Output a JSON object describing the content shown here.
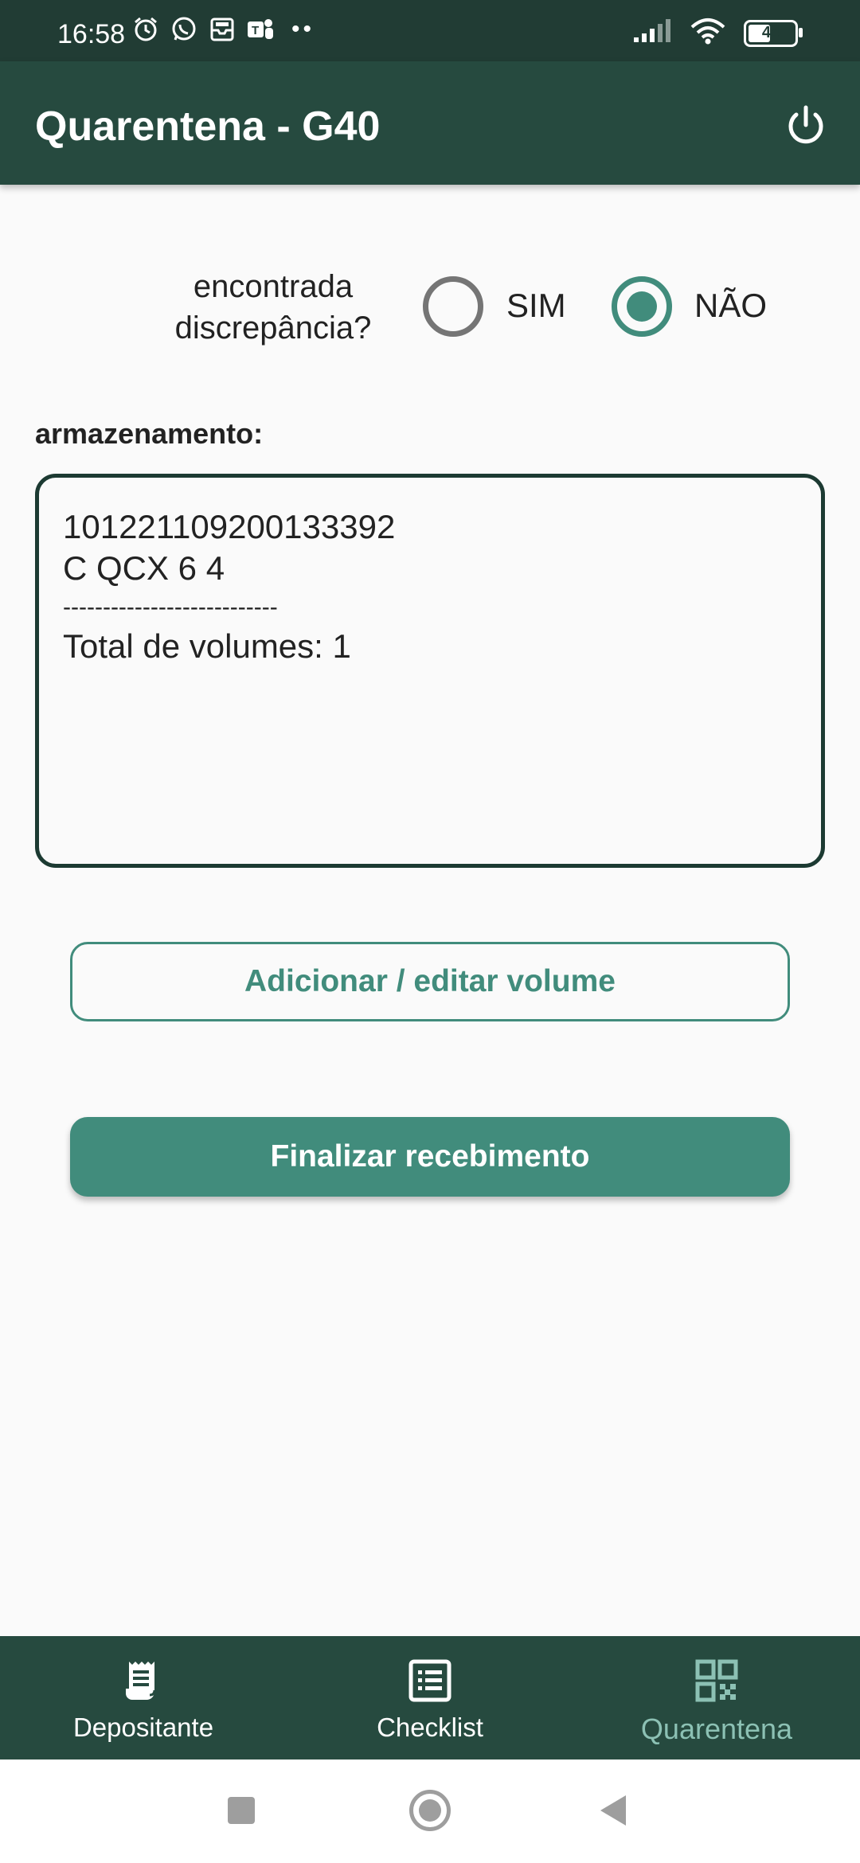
{
  "status_bar": {
    "time": "16:58",
    "battery": "44",
    "icons": [
      "alarm-icon",
      "whatsapp-icon",
      "inbox-icon",
      "teams-icon",
      "more-dots-icon",
      "signal-icon",
      "wifi-icon",
      "battery-icon"
    ]
  },
  "appbar": {
    "title": "Quarentena - G40",
    "power_icon": "power-icon"
  },
  "discrepancy": {
    "question_line1": "encontrada",
    "question_line2": "discrepância?",
    "option_yes": "SIM",
    "option_no": "NÃO",
    "selected": "NÃO"
  },
  "storage": {
    "label": "armazenamento:",
    "lines": [
      "101221109200133392",
      "C QCX 6 4",
      "---------------------------",
      "Total de volumes: 1"
    ]
  },
  "buttons": {
    "add_edit": "Adicionar / editar volume",
    "finish": "Finalizar recebimento"
  },
  "bottom_nav": {
    "items": [
      {
        "label": "Depositante",
        "icon": "receipt-icon"
      },
      {
        "label": "Checklist",
        "icon": "checklist-icon"
      },
      {
        "label": "Quarentena",
        "icon": "qr-code-icon",
        "active": true
      }
    ]
  },
  "colors": {
    "primary_dark": "#264a3f",
    "status_bar": "#213c34",
    "accent": "#418c7c",
    "accent_light": "#8cc1b4",
    "background": "#fafafa"
  }
}
